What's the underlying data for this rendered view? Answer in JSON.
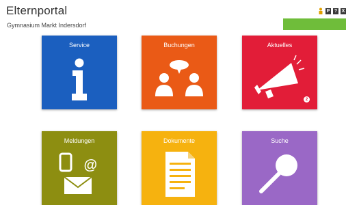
{
  "header": {
    "title": "Elternportal",
    "subtitle": "Gymnasium Markt Indersdorf"
  },
  "top_icons": [
    {
      "name": "user-icon"
    },
    {
      "name": "key-icon",
      "glyph": "P"
    },
    {
      "name": "help-icon",
      "glyph": "?"
    },
    {
      "name": "logout-icon",
      "glyph": "X"
    }
  ],
  "tiles": [
    {
      "label": "Service",
      "icon": "info-icon",
      "color": "#1b5fbf"
    },
    {
      "label": "Buchungen",
      "icon": "people-chat-icon",
      "color": "#ea5a16"
    },
    {
      "label": "Aktuelles",
      "icon": "megaphone-icon",
      "color": "#e21d38",
      "badge": "2"
    },
    {
      "label": "Meldungen",
      "icon": "phone-at-mail-icon",
      "color": "#8d8e11"
    },
    {
      "label": "Dokumente",
      "icon": "document-icon",
      "color": "#f6b20f"
    },
    {
      "label": "Suche",
      "icon": "magnifier-icon",
      "color": "#9a68c6"
    }
  ],
  "colors": {
    "accent_bar": "#6fbd3a"
  }
}
